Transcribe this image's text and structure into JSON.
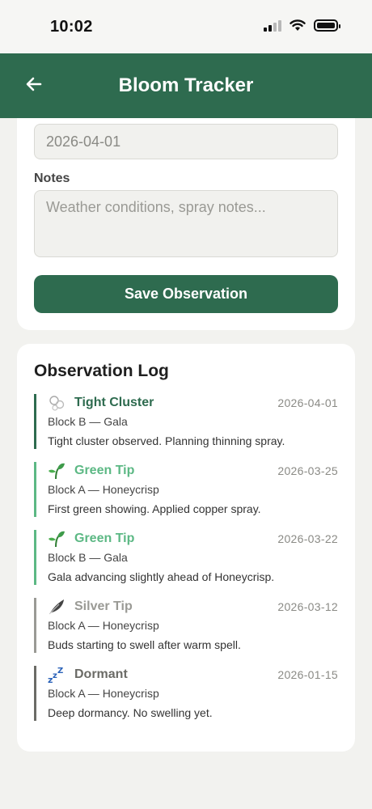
{
  "status_bar": {
    "time": "10:02"
  },
  "header": {
    "title": "Bloom Tracker"
  },
  "form": {
    "date_value": "2026-04-01",
    "notes_label": "Notes",
    "notes_placeholder": "Weather conditions, spray notes...",
    "save_label": "Save Observation"
  },
  "log": {
    "title": "Observation Log",
    "entries": [
      {
        "stage": "Tight Cluster",
        "date": "2026-04-01",
        "block": "Block B — Gala",
        "note": "Tight cluster observed. Planning thinning spray.",
        "icon": "bud-cluster-icon",
        "color": "#2e6b4f"
      },
      {
        "stage": "Green Tip",
        "date": "2026-03-25",
        "block": "Block A — Honeycrisp",
        "note": "First green showing. Applied copper spray.",
        "icon": "seedling-icon",
        "color": "#5cb884"
      },
      {
        "stage": "Green Tip",
        "date": "2026-03-22",
        "block": "Block B — Gala",
        "note": "Gala advancing slightly ahead of Honeycrisp.",
        "icon": "seedling-icon",
        "color": "#5cb884"
      },
      {
        "stage": "Silver Tip",
        "date": "2026-03-12",
        "block": "Block A — Honeycrisp",
        "note": "Buds starting to swell after warm spell.",
        "icon": "feather-icon",
        "color": "#9a9a95"
      },
      {
        "stage": "Dormant",
        "date": "2026-01-15",
        "block": "Block A — Honeycrisp",
        "note": "Deep dormancy. No swelling yet.",
        "icon": "zzz-icon",
        "color": "#6b6b66"
      }
    ]
  },
  "colors": {
    "brand": "#2e6b4f",
    "background": "#f2f2ef",
    "green_tip": "#5cb884",
    "silver_tip": "#9a9a95"
  }
}
